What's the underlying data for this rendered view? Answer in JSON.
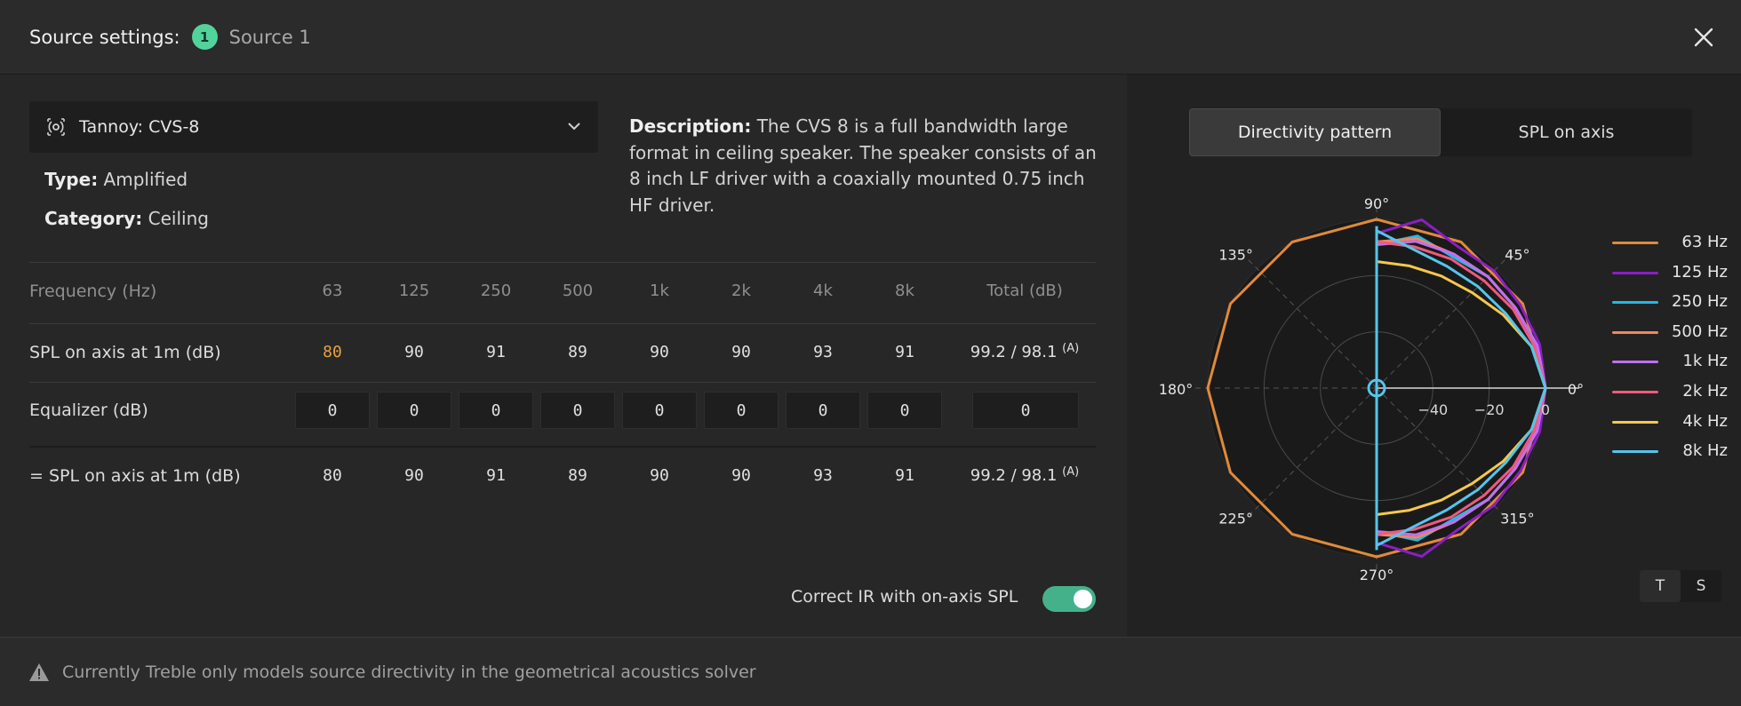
{
  "header": {
    "title": "Source settings:",
    "badge": "1",
    "source_name": "Source 1"
  },
  "source": {
    "selected": "Tannoy: CVS-8",
    "type_label": "Type:",
    "type_value": "Amplified",
    "category_label": "Category:",
    "category_value": "Ceiling",
    "description_label": "Description:",
    "description": "The CVS 8 is a full bandwidth large format in ceiling speaker. The speaker consists of an 8 inch LF driver with a coaxially mounted 0.75 inch HF driver."
  },
  "table": {
    "header_label": "Frequency (Hz)",
    "frequencies": [
      "63",
      "125",
      "250",
      "500",
      "1k",
      "2k",
      "4k",
      "8k"
    ],
    "total_label": "Total (dB)",
    "spl_label": "SPL on axis at 1m (dB)",
    "spl_values": [
      "80",
      "90",
      "91",
      "89",
      "90",
      "90",
      "93",
      "91"
    ],
    "spl_total": "99.2 / 98.1",
    "weight_suffix": "(A)",
    "eq_label": "Equalizer (dB)",
    "eq_values": [
      "0",
      "0",
      "0",
      "0",
      "0",
      "0",
      "0",
      "0"
    ],
    "eq_total": "0",
    "result_label": "= SPL on axis at 1m (dB)",
    "result_values": [
      "80",
      "90",
      "91",
      "89",
      "90",
      "90",
      "93",
      "91"
    ],
    "result_total": "99.2 / 98.1",
    "highlight_color": "#e8a040"
  },
  "toggle": {
    "label": "Correct IR with on-axis SPL",
    "on": true,
    "color": "#45b18a"
  },
  "tabs": [
    "Directivity pattern",
    "SPL on axis"
  ],
  "active_tab": 0,
  "chart_data": {
    "type": "polar",
    "angular_labels": [
      "0°",
      "45°",
      "90°",
      "135°",
      "180°",
      "225°",
      "270°",
      "315°"
    ],
    "radial_tick_labels": [
      "−40",
      "−20",
      "0"
    ],
    "radial_range_db": [
      -60,
      0
    ],
    "grid": true,
    "legend_position": "right",
    "series": [
      {
        "name": "63 Hz",
        "color": "#e08a3a",
        "angles_deg": [
          0,
          30,
          60,
          90,
          120,
          150,
          180,
          210,
          240,
          270,
          300,
          330,
          360
        ],
        "values_db": [
          0,
          0,
          0,
          0,
          0,
          0,
          0,
          0,
          0,
          0,
          0,
          0,
          0
        ]
      },
      {
        "name": "125 Hz",
        "color": "#8a1fc4",
        "angles_deg": [
          -90,
          -75,
          -60,
          -45,
          -30,
          -15,
          0,
          15,
          30,
          45,
          60,
          75,
          90
        ],
        "values_db": [
          -5,
          2,
          -2,
          -1,
          -1,
          0,
          0,
          0,
          -1,
          -1,
          -2,
          2,
          -5
        ]
      },
      {
        "name": "250 Hz",
        "color": "#22b9e6",
        "angles_deg": [
          -90,
          -75,
          -60,
          -45,
          -30,
          -15,
          0,
          15,
          30,
          45,
          60,
          75,
          90
        ],
        "values_db": [
          -9,
          -4,
          -6,
          -4,
          -3,
          -1,
          0,
          -1,
          -3,
          -4,
          -6,
          -4,
          -9
        ]
      },
      {
        "name": "500 Hz",
        "color": "#f08860",
        "angles_deg": [
          -90,
          -75,
          -60,
          -45,
          -30,
          -15,
          0,
          15,
          30,
          45,
          60,
          75,
          90
        ],
        "values_db": [
          -8,
          -5,
          -5,
          -4,
          -3,
          -1,
          0,
          -1,
          -3,
          -4,
          -5,
          -5,
          -8
        ]
      },
      {
        "name": "1k Hz",
        "color": "#c070f0",
        "angles_deg": [
          -90,
          -75,
          -60,
          -45,
          -30,
          -15,
          0,
          15,
          30,
          45,
          60,
          75,
          90
        ],
        "values_db": [
          -9,
          -6,
          -5,
          -4,
          -3,
          -1,
          0,
          -1,
          -3,
          -4,
          -5,
          -6,
          -9
        ]
      },
      {
        "name": "2k Hz",
        "color": "#f05a7c",
        "angles_deg": [
          -90,
          -75,
          -60,
          -45,
          -30,
          -15,
          0,
          15,
          30,
          45,
          60,
          75,
          90
        ],
        "values_db": [
          -8,
          -8,
          -7,
          -6,
          -4,
          -2,
          0,
          -2,
          -4,
          -6,
          -7,
          -8,
          -8
        ]
      },
      {
        "name": "4k Hz",
        "color": "#f5c84c",
        "angles_deg": [
          -90,
          -75,
          -60,
          -45,
          -30,
          -15,
          0,
          15,
          30,
          45,
          60,
          75,
          90
        ],
        "values_db": [
          -15,
          -15,
          -14,
          -12,
          -8,
          -3,
          0,
          -3,
          -8,
          -12,
          -14,
          -15,
          -15
        ]
      },
      {
        "name": "8k Hz",
        "color": "#55c5ec",
        "angles_deg": [
          -90,
          -75,
          -60,
          -45,
          -30,
          -15,
          0,
          15,
          30,
          45,
          60,
          75,
          90
        ],
        "values_db": [
          -4,
          -9,
          -10,
          -9,
          -7,
          -3,
          0,
          -3,
          -7,
          -9,
          -10,
          -9,
          -4
        ]
      }
    ]
  },
  "ts_toggle": [
    "T",
    "S"
  ],
  "footer": {
    "message": "Currently Treble only models source directivity in the geometrical acoustics solver"
  }
}
